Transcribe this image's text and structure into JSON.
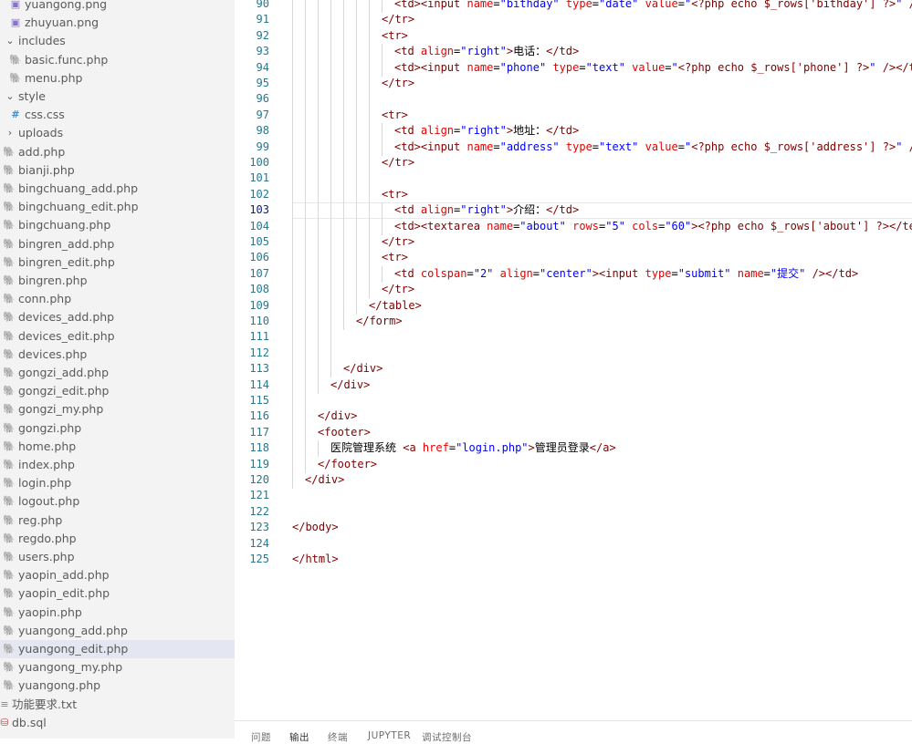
{
  "explorer": {
    "items": [
      {
        "label": "yuangong.png",
        "icon": "image-icon",
        "indent": 1
      },
      {
        "label": "zhuyuan.png",
        "icon": "image-icon",
        "indent": 1
      },
      {
        "label": "includes",
        "icon": "chevron-down-icon",
        "indent": 0
      },
      {
        "label": "basic.func.php",
        "icon": "php-elephant-icon",
        "indent": 1
      },
      {
        "label": "menu.php",
        "icon": "php-elephant-icon",
        "indent": 1
      },
      {
        "label": "style",
        "icon": "chevron-down-icon",
        "indent": 0
      },
      {
        "label": "css.css",
        "icon": "css-hash-icon",
        "indent": 1
      },
      {
        "label": "uploads",
        "icon": "chevron-right-icon",
        "indent": 0
      },
      {
        "label": "add.php",
        "icon": "php-elephant-icon",
        "indent": 0
      },
      {
        "label": "bianji.php",
        "icon": "php-elephant-icon",
        "indent": 0
      },
      {
        "label": "bingchuang_add.php",
        "icon": "php-elephant-icon",
        "indent": 0
      },
      {
        "label": "bingchuang_edit.php",
        "icon": "php-elephant-icon",
        "indent": 0
      },
      {
        "label": "bingchuang.php",
        "icon": "php-elephant-icon",
        "indent": 0
      },
      {
        "label": "bingren_add.php",
        "icon": "php-elephant-icon",
        "indent": 0
      },
      {
        "label": "bingren_edit.php",
        "icon": "php-elephant-icon",
        "indent": 0
      },
      {
        "label": "bingren.php",
        "icon": "php-elephant-icon",
        "indent": 0
      },
      {
        "label": "conn.php",
        "icon": "php-elephant-icon",
        "indent": 0
      },
      {
        "label": "devices_add.php",
        "icon": "php-elephant-icon",
        "indent": 0
      },
      {
        "label": "devices_edit.php",
        "icon": "php-elephant-icon",
        "indent": 0
      },
      {
        "label": "devices.php",
        "icon": "php-elephant-icon",
        "indent": 0
      },
      {
        "label": "gongzi_add.php",
        "icon": "php-elephant-icon",
        "indent": 0
      },
      {
        "label": "gongzi_edit.php",
        "icon": "php-elephant-icon",
        "indent": 0
      },
      {
        "label": "gongzi_my.php",
        "icon": "php-elephant-icon",
        "indent": 0
      },
      {
        "label": "gongzi.php",
        "icon": "php-elephant-icon",
        "indent": 0
      },
      {
        "label": "home.php",
        "icon": "php-elephant-icon",
        "indent": 0
      },
      {
        "label": "index.php",
        "icon": "php-elephant-icon",
        "indent": 0
      },
      {
        "label": "login.php",
        "icon": "php-elephant-icon",
        "indent": 0
      },
      {
        "label": "logout.php",
        "icon": "php-elephant-icon",
        "indent": 0
      },
      {
        "label": "reg.php",
        "icon": "php-elephant-icon",
        "indent": 0
      },
      {
        "label": "regdo.php",
        "icon": "php-elephant-icon",
        "indent": 0
      },
      {
        "label": "users.php",
        "icon": "php-elephant-icon",
        "indent": 0
      },
      {
        "label": "yaopin_add.php",
        "icon": "php-elephant-icon",
        "indent": 0
      },
      {
        "label": "yaopin_edit.php",
        "icon": "php-elephant-icon",
        "indent": 0
      },
      {
        "label": "yaopin.php",
        "icon": "php-elephant-icon",
        "indent": 0
      },
      {
        "label": "yuangong_add.php",
        "icon": "php-elephant-icon",
        "indent": 0
      },
      {
        "label": "yuangong_edit.php",
        "icon": "php-elephant-icon",
        "indent": 0,
        "selected": true
      },
      {
        "label": "yuangong_my.php",
        "icon": "php-elephant-icon",
        "indent": 0
      },
      {
        "label": "yuangong.php",
        "icon": "php-elephant-icon",
        "indent": 0
      },
      {
        "label": "功能要求.txt",
        "icon": "text-file-icon",
        "indent": -1
      },
      {
        "label": "db.sql",
        "icon": "database-icon",
        "indent": -1
      }
    ]
  },
  "editor": {
    "current_line": 103,
    "lines": [
      {
        "n": 90,
        "indent": 8,
        "tokens": [
          [
            "tag",
            "<td><input "
          ],
          [
            "attr",
            "name"
          ],
          [
            "text",
            "="
          ],
          [
            "str",
            "\"bithday\""
          ],
          [
            "text",
            " "
          ],
          [
            "attr",
            "type"
          ],
          [
            "text",
            "="
          ],
          [
            "str",
            "\"date\""
          ],
          [
            "text",
            " "
          ],
          [
            "attr",
            "value"
          ],
          [
            "text",
            "="
          ],
          [
            "str",
            "\""
          ],
          [
            "php",
            "<?php echo $_rows['bithday'] ?>"
          ],
          [
            "str",
            "\""
          ],
          [
            "tag",
            " />"
          ]
        ]
      },
      {
        "n": 91,
        "indent": 7,
        "tokens": [
          [
            "tag",
            "</tr>"
          ]
        ]
      },
      {
        "n": 92,
        "indent": 7,
        "tokens": [
          [
            "tag",
            "<tr>"
          ]
        ]
      },
      {
        "n": 93,
        "indent": 8,
        "tokens": [
          [
            "tag",
            "<td "
          ],
          [
            "attr",
            "align"
          ],
          [
            "text",
            "="
          ],
          [
            "str",
            "\"right\""
          ],
          [
            "tag",
            ">"
          ],
          [
            "text",
            "电话："
          ],
          [
            "tag",
            "</td>"
          ]
        ]
      },
      {
        "n": 94,
        "indent": 8,
        "tokens": [
          [
            "tag",
            "<td><input "
          ],
          [
            "attr",
            "name"
          ],
          [
            "text",
            "="
          ],
          [
            "str",
            "\"phone\""
          ],
          [
            "text",
            " "
          ],
          [
            "attr",
            "type"
          ],
          [
            "text",
            "="
          ],
          [
            "str",
            "\"text\""
          ],
          [
            "text",
            " "
          ],
          [
            "attr",
            "value"
          ],
          [
            "text",
            "="
          ],
          [
            "str",
            "\""
          ],
          [
            "php",
            "<?php echo $_rows['phone'] ?>"
          ],
          [
            "str",
            "\""
          ],
          [
            "tag",
            " /></td"
          ]
        ]
      },
      {
        "n": 95,
        "indent": 7,
        "tokens": [
          [
            "tag",
            "</tr>"
          ]
        ]
      },
      {
        "n": 96,
        "indent": 7,
        "tokens": []
      },
      {
        "n": 97,
        "indent": 7,
        "tokens": [
          [
            "tag",
            "<tr>"
          ]
        ]
      },
      {
        "n": 98,
        "indent": 8,
        "tokens": [
          [
            "tag",
            "<td "
          ],
          [
            "attr",
            "align"
          ],
          [
            "text",
            "="
          ],
          [
            "str",
            "\"right\""
          ],
          [
            "tag",
            ">"
          ],
          [
            "text",
            "地址："
          ],
          [
            "tag",
            "</td>"
          ]
        ]
      },
      {
        "n": 99,
        "indent": 8,
        "tokens": [
          [
            "tag",
            "<td><input "
          ],
          [
            "attr",
            "name"
          ],
          [
            "text",
            "="
          ],
          [
            "str",
            "\"address\""
          ],
          [
            "text",
            " "
          ],
          [
            "attr",
            "type"
          ],
          [
            "text",
            "="
          ],
          [
            "str",
            "\"text\""
          ],
          [
            "text",
            " "
          ],
          [
            "attr",
            "value"
          ],
          [
            "text",
            "="
          ],
          [
            "str",
            "\""
          ],
          [
            "php",
            "<?php echo $_rows['address'] ?>"
          ],
          [
            "str",
            "\""
          ],
          [
            "tag",
            " />"
          ]
        ]
      },
      {
        "n": 100,
        "indent": 7,
        "tokens": [
          [
            "tag",
            "</tr>"
          ]
        ]
      },
      {
        "n": 101,
        "indent": 7,
        "tokens": []
      },
      {
        "n": 102,
        "indent": 7,
        "tokens": [
          [
            "tag",
            "<tr>"
          ]
        ]
      },
      {
        "n": 103,
        "indent": 8,
        "tokens": [
          [
            "tag",
            "<td "
          ],
          [
            "attr",
            "align"
          ],
          [
            "text",
            "="
          ],
          [
            "str",
            "\"right\""
          ],
          [
            "tag",
            ">"
          ],
          [
            "text",
            "介绍："
          ],
          [
            "tag",
            "</td>"
          ]
        ]
      },
      {
        "n": 104,
        "indent": 8,
        "tokens": [
          [
            "tag",
            "<td><textarea "
          ],
          [
            "attr",
            "name"
          ],
          [
            "text",
            "="
          ],
          [
            "str",
            "\"about\""
          ],
          [
            "text",
            " "
          ],
          [
            "attr",
            "rows"
          ],
          [
            "text",
            "="
          ],
          [
            "str",
            "\"5\""
          ],
          [
            "text",
            " "
          ],
          [
            "attr",
            "cols"
          ],
          [
            "text",
            "="
          ],
          [
            "str",
            "\"60\""
          ],
          [
            "tag",
            ">"
          ],
          [
            "php",
            "<?php echo $_rows['about'] ?>"
          ],
          [
            "tag",
            "</text"
          ]
        ]
      },
      {
        "n": 105,
        "indent": 7,
        "tokens": [
          [
            "tag",
            "</tr>"
          ]
        ]
      },
      {
        "n": 106,
        "indent": 7,
        "tokens": [
          [
            "tag",
            "<tr>"
          ]
        ]
      },
      {
        "n": 107,
        "indent": 8,
        "tokens": [
          [
            "tag",
            "<td "
          ],
          [
            "attr",
            "colspan"
          ],
          [
            "text",
            "="
          ],
          [
            "str",
            "\"2\""
          ],
          [
            "text",
            " "
          ],
          [
            "attr",
            "align"
          ],
          [
            "text",
            "="
          ],
          [
            "str",
            "\"center\""
          ],
          [
            "tag",
            "><input "
          ],
          [
            "attr",
            "type"
          ],
          [
            "text",
            "="
          ],
          [
            "str",
            "\"submit\""
          ],
          [
            "text",
            " "
          ],
          [
            "attr",
            "name"
          ],
          [
            "text",
            "="
          ],
          [
            "str",
            "\"提交\""
          ],
          [
            "tag",
            " /></td>"
          ]
        ]
      },
      {
        "n": 108,
        "indent": 7,
        "tokens": [
          [
            "tag",
            "</tr>"
          ]
        ]
      },
      {
        "n": 109,
        "indent": 6,
        "tokens": [
          [
            "tag",
            "</table>"
          ]
        ]
      },
      {
        "n": 110,
        "indent": 5,
        "tokens": [
          [
            "tag",
            "</form>"
          ]
        ]
      },
      {
        "n": 111,
        "indent": 4,
        "tokens": []
      },
      {
        "n": 112,
        "indent": 4,
        "tokens": []
      },
      {
        "n": 113,
        "indent": 4,
        "tokens": [
          [
            "tag",
            "</div>"
          ]
        ]
      },
      {
        "n": 114,
        "indent": 3,
        "tokens": [
          [
            "tag",
            "</div>"
          ]
        ]
      },
      {
        "n": 115,
        "indent": 2,
        "tokens": []
      },
      {
        "n": 116,
        "indent": 2,
        "tokens": [
          [
            "tag",
            "</div>"
          ]
        ]
      },
      {
        "n": 117,
        "indent": 2,
        "tokens": [
          [
            "tag",
            "<footer>"
          ]
        ]
      },
      {
        "n": 118,
        "indent": 3,
        "tokens": [
          [
            "text",
            "医院管理系统 "
          ],
          [
            "tag",
            "<a "
          ],
          [
            "attr",
            "href"
          ],
          [
            "text",
            "="
          ],
          [
            "str",
            "\"login.php\""
          ],
          [
            "tag",
            ">"
          ],
          [
            "text",
            "管理员登录"
          ],
          [
            "tag",
            "</a>"
          ]
        ]
      },
      {
        "n": 119,
        "indent": 2,
        "tokens": [
          [
            "tag",
            "</footer>"
          ]
        ]
      },
      {
        "n": 120,
        "indent": 1,
        "tokens": [
          [
            "tag",
            "</div>"
          ]
        ]
      },
      {
        "n": 121,
        "indent": 0,
        "tokens": []
      },
      {
        "n": 122,
        "indent": 0,
        "tokens": []
      },
      {
        "n": 123,
        "indent": 0,
        "tokens": [
          [
            "tag",
            "</body>"
          ]
        ]
      },
      {
        "n": 124,
        "indent": 0,
        "tokens": []
      },
      {
        "n": 125,
        "indent": 0,
        "tokens": [
          [
            "tag",
            "</html>"
          ]
        ]
      }
    ]
  },
  "panel": {
    "tabs": [
      {
        "label": "问题"
      },
      {
        "label": "输出",
        "active": true
      },
      {
        "label": "终端"
      },
      {
        "label": "JUPYTER"
      },
      {
        "label": "调试控制台"
      }
    ]
  },
  "colors": {
    "tag": "#800000",
    "attribute": "#e50000",
    "string": "#0000ff",
    "line_number": "#237893",
    "selection": "#e4e6f1"
  }
}
